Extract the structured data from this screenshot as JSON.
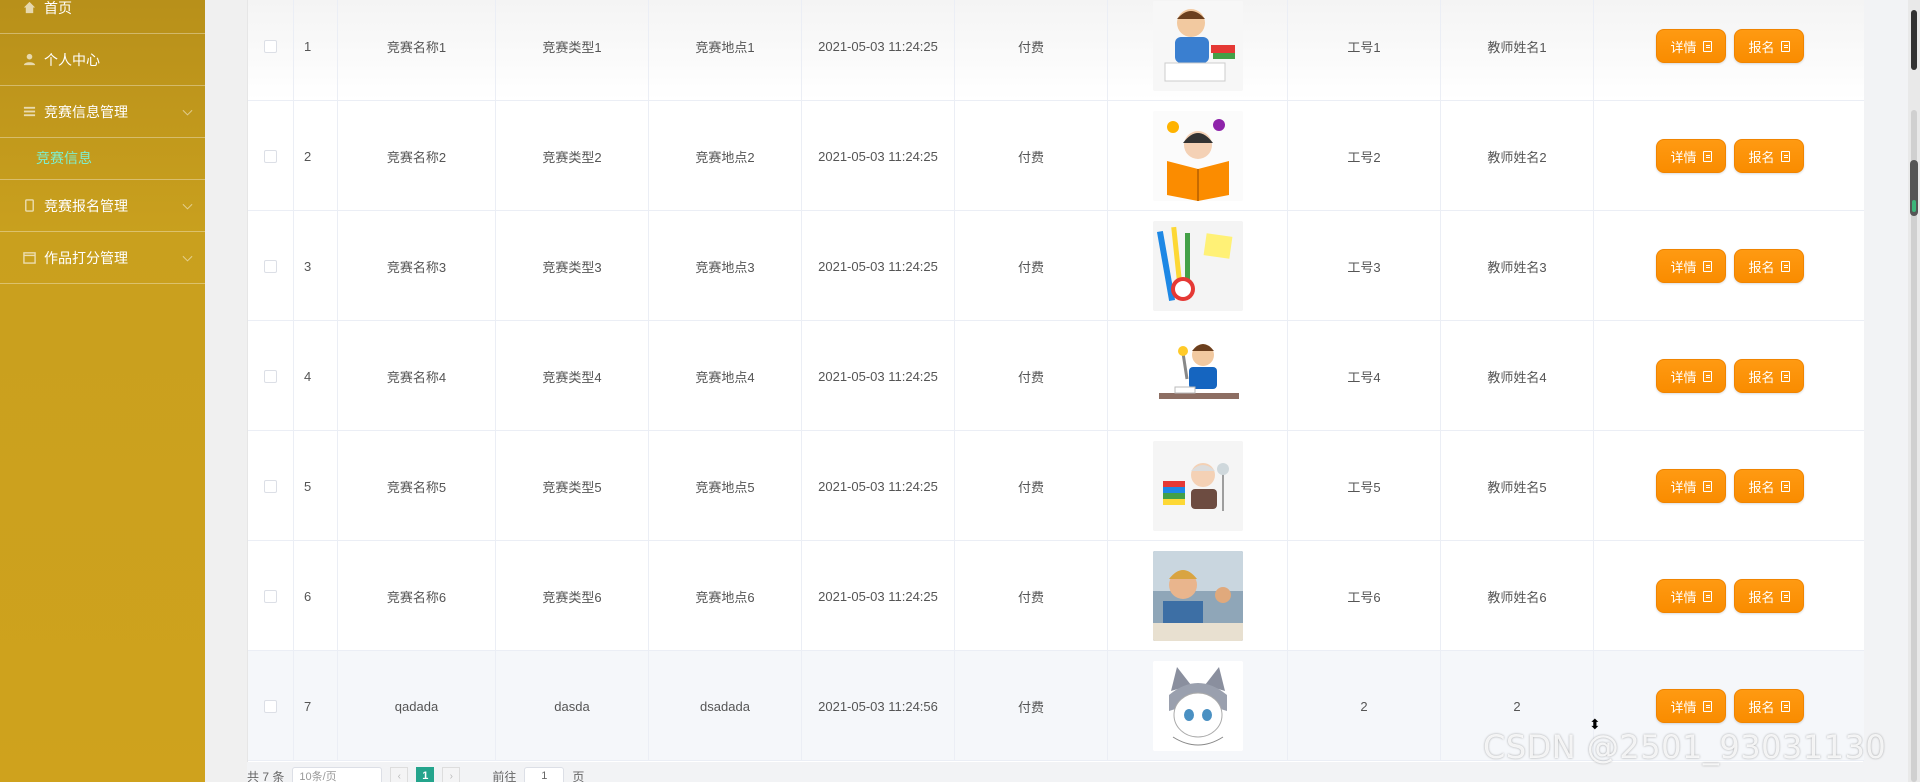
{
  "sidebar": {
    "items": [
      {
        "label": "首页",
        "icon": "home-icon"
      },
      {
        "label": "个人中心",
        "icon": "user-icon"
      },
      {
        "label": "竞赛信息管理",
        "icon": "list-icon"
      },
      {
        "label": "竞赛报名管理",
        "icon": "clipboard-icon"
      },
      {
        "label": "作品打分管理",
        "icon": "calendar-icon"
      }
    ],
    "sub_item": "竞赛信息",
    "accent": "#7ef0d0",
    "bg": "#c9a01e"
  },
  "table": {
    "rows": [
      {
        "index": "1",
        "name": "竞赛名称1",
        "type": "竞赛类型1",
        "place": "竞赛地点1",
        "time": "2021-05-03 11:24:25",
        "fee": "付费",
        "emp_no": "工号1",
        "teacher": "教师姓名1",
        "art": "boy-reading"
      },
      {
        "index": "2",
        "name": "竞赛名称2",
        "type": "竞赛类型2",
        "place": "竞赛地点2",
        "time": "2021-05-03 11:24:25",
        "fee": "付费",
        "emp_no": "工号2",
        "teacher": "教师姓名2",
        "art": "girl-book"
      },
      {
        "index": "3",
        "name": "竞赛名称3",
        "type": "竞赛类型3",
        "place": "竞赛地点3",
        "time": "2021-05-03 11:24:25",
        "fee": "付费",
        "emp_no": "工号3",
        "teacher": "教师姓名3",
        "art": "stationery-clock"
      },
      {
        "index": "4",
        "name": "竞赛名称4",
        "type": "竞赛类型4",
        "place": "竞赛地点4",
        "time": "2021-05-03 11:24:25",
        "fee": "付费",
        "emp_no": "工号4",
        "teacher": "教师姓名4",
        "art": "boy-desk"
      },
      {
        "index": "5",
        "name": "竞赛名称5",
        "type": "竞赛类型5",
        "place": "竞赛地点5",
        "time": "2021-05-03 11:24:25",
        "fee": "付费",
        "emp_no": "工号5",
        "teacher": "教师姓名5",
        "art": "old-reader"
      },
      {
        "index": "6",
        "name": "竞赛名称6",
        "type": "竞赛类型6",
        "place": "竞赛地点6",
        "time": "2021-05-03 11:24:25",
        "fee": "付费",
        "emp_no": "工号6",
        "teacher": "教师姓名6",
        "art": "photo-classroom"
      },
      {
        "index": "7",
        "name": "qadada",
        "type": "dasda",
        "place": "dsadada",
        "time": "2021-05-03 11:24:56",
        "fee": "付费",
        "emp_no": "2",
        "teacher": "2",
        "art": "anime-cat"
      }
    ],
    "detail_label": "详情",
    "signup_label": "报名",
    "button_color": "#f98c00"
  },
  "pager": {
    "total": "共 7 条",
    "page_size": "10条/页",
    "prev": "‹",
    "current": "1",
    "next": "›",
    "goto_label": "前往",
    "goto_value": "1",
    "page_unit": "页"
  },
  "watermark": "CSDN @2501_93031130"
}
